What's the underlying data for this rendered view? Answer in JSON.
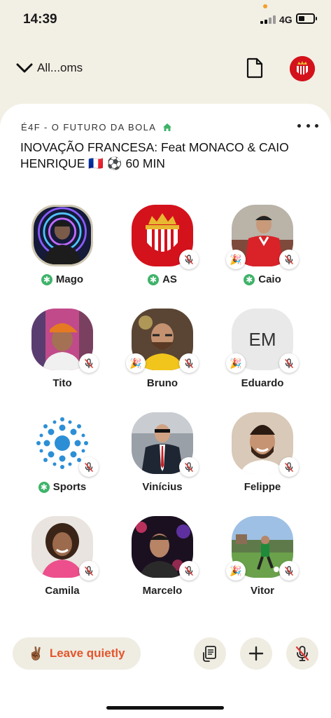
{
  "status": {
    "time": "14:39",
    "network": "4G"
  },
  "nav": {
    "back_label": "All...oms"
  },
  "room": {
    "club_name": "É4F - O FUTURO DA BOLA",
    "title": "INOVAÇÃO FRANCESA: Feat MONACO & CAIO HENRIQUE 🇫🇷 ⚽ 60 MIN"
  },
  "speakers": [
    {
      "name": "Mago",
      "moderator": true,
      "muted": false,
      "party": false,
      "avatar": "photo-person-neon-circles",
      "ring": true
    },
    {
      "name": "AS",
      "moderator": true,
      "muted": true,
      "party": false,
      "avatar": "as-monaco-crest"
    },
    {
      "name": "Caio",
      "moderator": true,
      "muted": true,
      "party": true,
      "avatar": "photo-player-red-jersey"
    },
    {
      "name": "Tito",
      "moderator": false,
      "muted": true,
      "party": false,
      "avatar": "photo-man-orange-cap"
    },
    {
      "name": "Bruno",
      "moderator": false,
      "muted": true,
      "party": true,
      "avatar": "photo-man-glasses-yellow"
    },
    {
      "name": "Eduardo",
      "moderator": false,
      "muted": true,
      "party": true,
      "avatar": "initials",
      "initials": "EM"
    },
    {
      "name": "Sports",
      "moderator": true,
      "muted": true,
      "party": false,
      "avatar": "blue-dots-logo"
    },
    {
      "name": "Vinícius",
      "moderator": false,
      "muted": true,
      "party": false,
      "avatar": "photo-man-suit-red-tie"
    },
    {
      "name": "Felippe",
      "moderator": false,
      "muted": true,
      "party": false,
      "avatar": "photo-smiling-bearded-man"
    },
    {
      "name": "Camila",
      "moderator": false,
      "muted": true,
      "party": false,
      "avatar": "photo-woman-pink-top"
    },
    {
      "name": "Marcelo",
      "moderator": false,
      "muted": true,
      "party": false,
      "avatar": "photo-man-party-lights"
    },
    {
      "name": "Vitor",
      "moderator": false,
      "muted": true,
      "party": true,
      "avatar": "photo-player-field"
    }
  ],
  "bottom": {
    "leave_label": "Leave quietly",
    "leave_emoji": "✌🏾"
  },
  "colors": {
    "leave_text": "#e3552b",
    "moderator_green": "#3fb36a",
    "background": "#f2efe4"
  }
}
